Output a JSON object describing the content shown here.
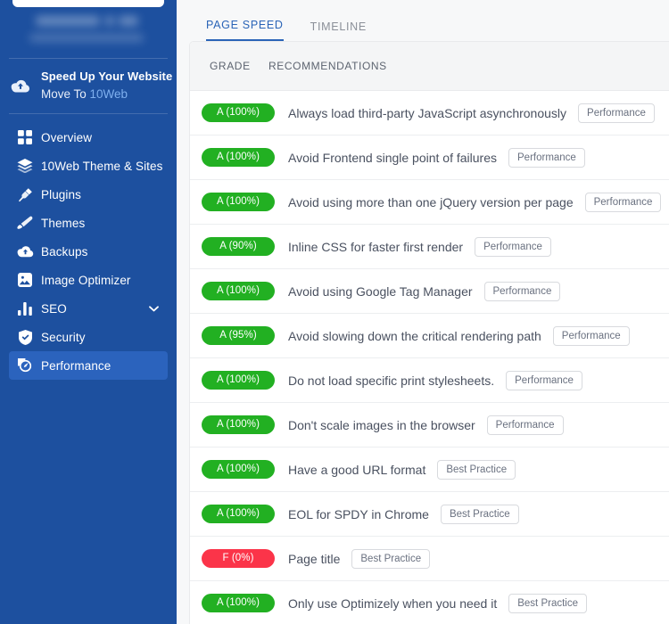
{
  "sidebar": {
    "promo": {
      "title": "Speed Up Your Website",
      "subtitle_prefix": "Move To ",
      "subtitle_highlight": "10Web",
      "icon": "cloud-upload-icon"
    },
    "items": [
      {
        "label": "Overview",
        "icon": "grid-icon",
        "active": false,
        "chevron": false
      },
      {
        "label": "10Web Theme & Sites",
        "icon": "layers-icon",
        "active": false,
        "chevron": false
      },
      {
        "label": "Plugins",
        "icon": "plug-icon",
        "active": false,
        "chevron": false
      },
      {
        "label": "Themes",
        "icon": "brush-icon",
        "active": false,
        "chevron": false
      },
      {
        "label": "Backups",
        "icon": "cloud-icon",
        "active": false,
        "chevron": false
      },
      {
        "label": "Image Optimizer",
        "icon": "image-icon",
        "active": false,
        "chevron": false
      },
      {
        "label": "SEO",
        "icon": "bar-chart-icon",
        "active": false,
        "chevron": true
      },
      {
        "label": "Security",
        "icon": "shield-icon",
        "active": false,
        "chevron": false
      },
      {
        "label": "Performance",
        "icon": "gauge-icon",
        "active": true,
        "chevron": false
      }
    ]
  },
  "main": {
    "tabs": [
      {
        "label": "PAGE SPEED",
        "active": true
      },
      {
        "label": "TIMELINE",
        "active": false
      }
    ],
    "table": {
      "columns": {
        "grade": "GRADE",
        "recommendations": "RECOMMENDATIONS"
      },
      "rows": [
        {
          "grade": "A (100%)",
          "grade_color": "#22b022",
          "recommendation": "Always load third-party JavaScript asynchronously",
          "tag": "Performance"
        },
        {
          "grade": "A (100%)",
          "grade_color": "#22b022",
          "recommendation": "Avoid Frontend single point of failures",
          "tag": "Performance"
        },
        {
          "grade": "A (100%)",
          "grade_color": "#22b022",
          "recommendation": "Avoid using more than one jQuery version per page",
          "tag": "Performance"
        },
        {
          "grade": "A (90%)",
          "grade_color": "#22b022",
          "recommendation": "Inline CSS for faster first render",
          "tag": "Performance"
        },
        {
          "grade": "A (100%)",
          "grade_color": "#22b022",
          "recommendation": "Avoid using Google Tag Manager",
          "tag": "Performance"
        },
        {
          "grade": "A (95%)",
          "grade_color": "#22b022",
          "recommendation": "Avoid slowing down the critical rendering path",
          "tag": "Performance"
        },
        {
          "grade": "A (100%)",
          "grade_color": "#22b022",
          "recommendation": "Do not load specific print stylesheets.",
          "tag": "Performance"
        },
        {
          "grade": "A (100%)",
          "grade_color": "#22b022",
          "recommendation": "Don't scale images in the browser",
          "tag": "Performance"
        },
        {
          "grade": "A (100%)",
          "grade_color": "#22b022",
          "recommendation": "Have a good URL format",
          "tag": "Best Practice"
        },
        {
          "grade": "A (100%)",
          "grade_color": "#22b022",
          "recommendation": "EOL for SPDY in Chrome",
          "tag": "Best Practice"
        },
        {
          "grade": "F (0%)",
          "grade_color": "#fb3449",
          "recommendation": "Page title",
          "tag": "Best Practice"
        },
        {
          "grade": "A (100%)",
          "grade_color": "#22b022",
          "recommendation": "Only use Optimizely when you need it",
          "tag": "Best Practice"
        }
      ]
    }
  },
  "colors": {
    "sidebar_bg": "#1d509f",
    "sidebar_active": "#2b63bd",
    "accent": "#2a64b7",
    "page_bg": "#f7f8f9",
    "grade_good": "#22b022",
    "grade_fail": "#fb3449"
  }
}
